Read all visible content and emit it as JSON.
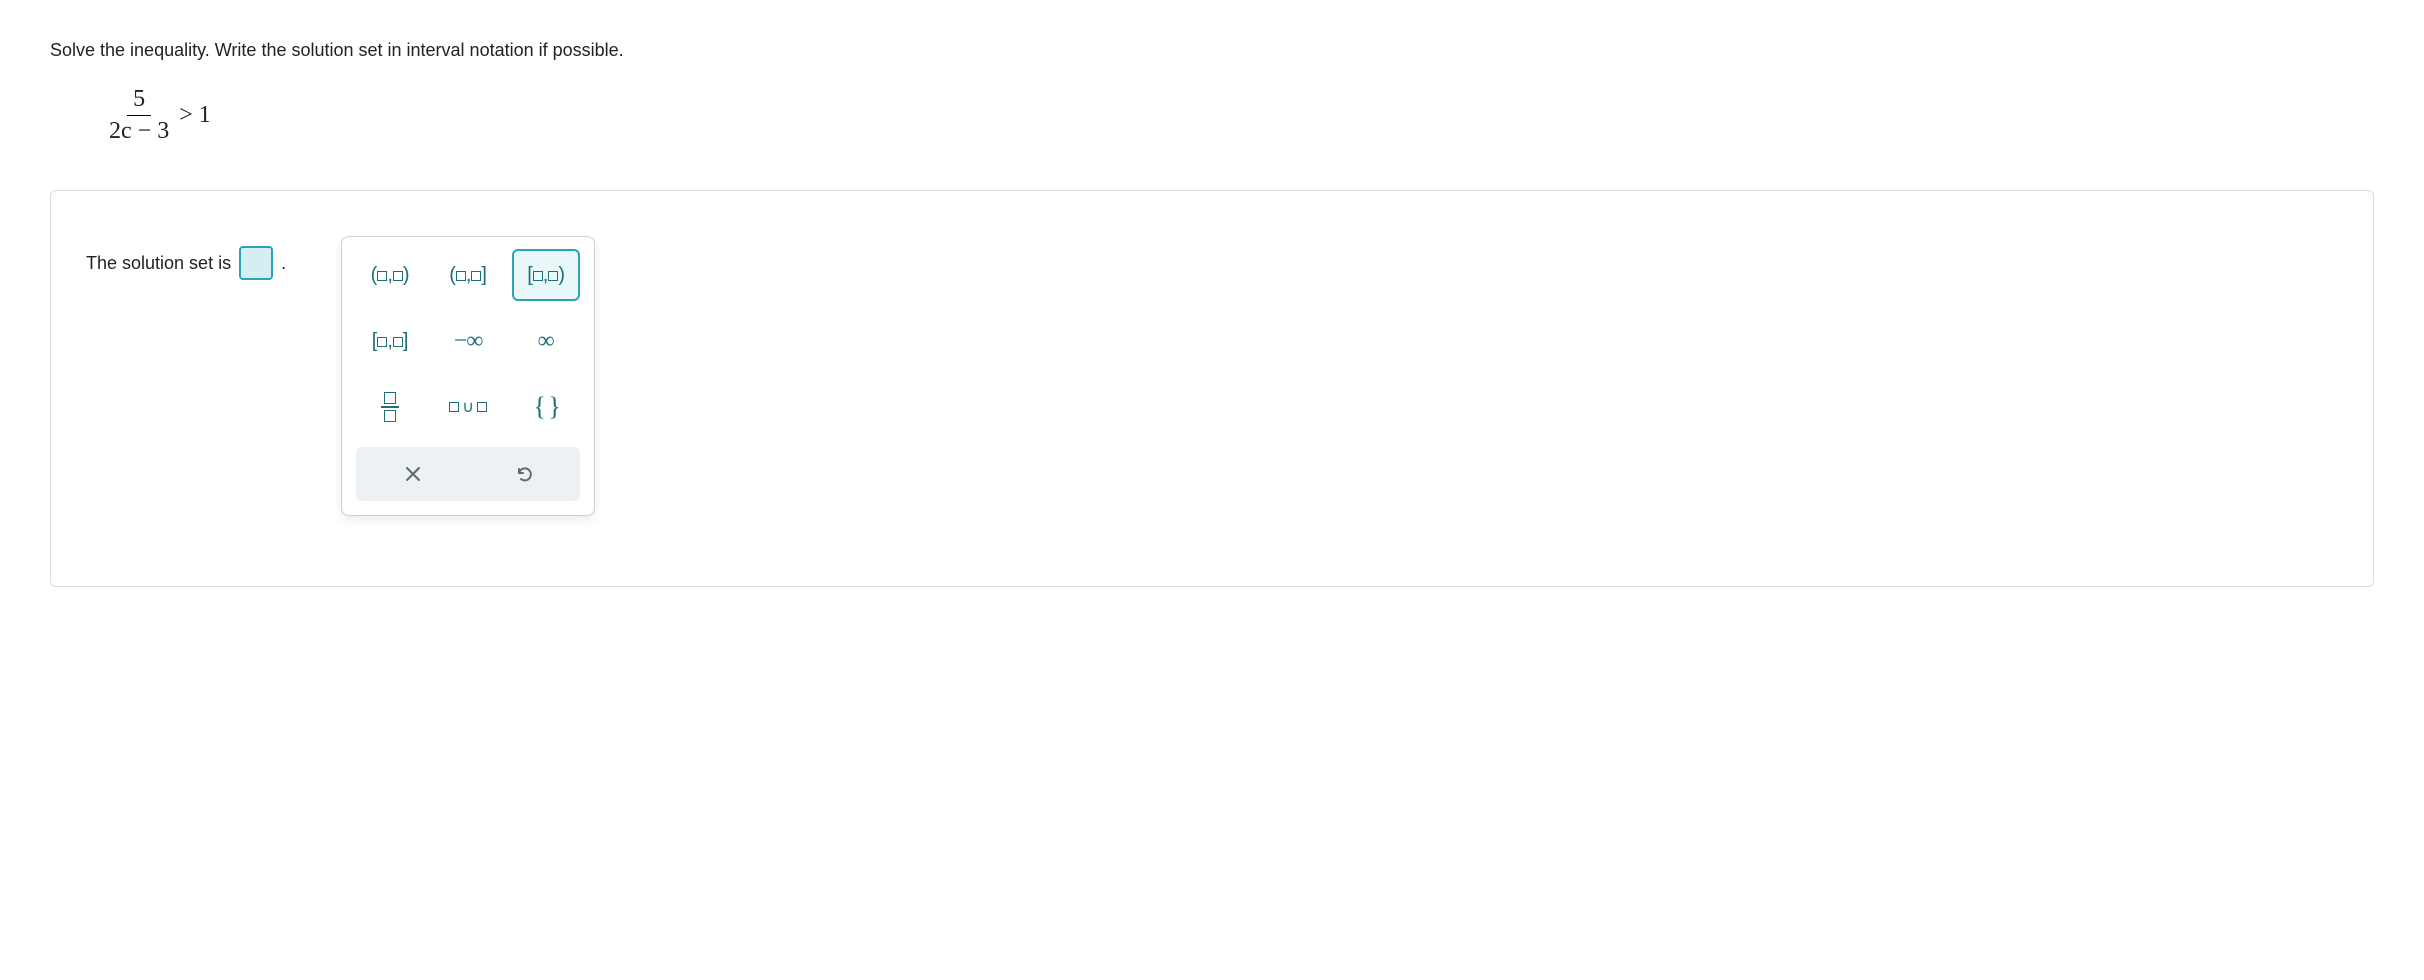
{
  "instruction": "Solve the inequality. Write the solution set in interval notation if possible.",
  "equation": {
    "numerator": "5",
    "denominator": "2c − 3",
    "relation": "> 1"
  },
  "prompt_label": "The solution set is",
  "prompt_tail": ".",
  "palette": {
    "open_open": "(□,□)",
    "open_closed": "(□,□]",
    "closed_open": "[□,□)",
    "closed_closed": "[□,□]",
    "neg_inf": "−∞",
    "pos_inf": "∞",
    "union_u": "∪",
    "braces": "{ }"
  }
}
